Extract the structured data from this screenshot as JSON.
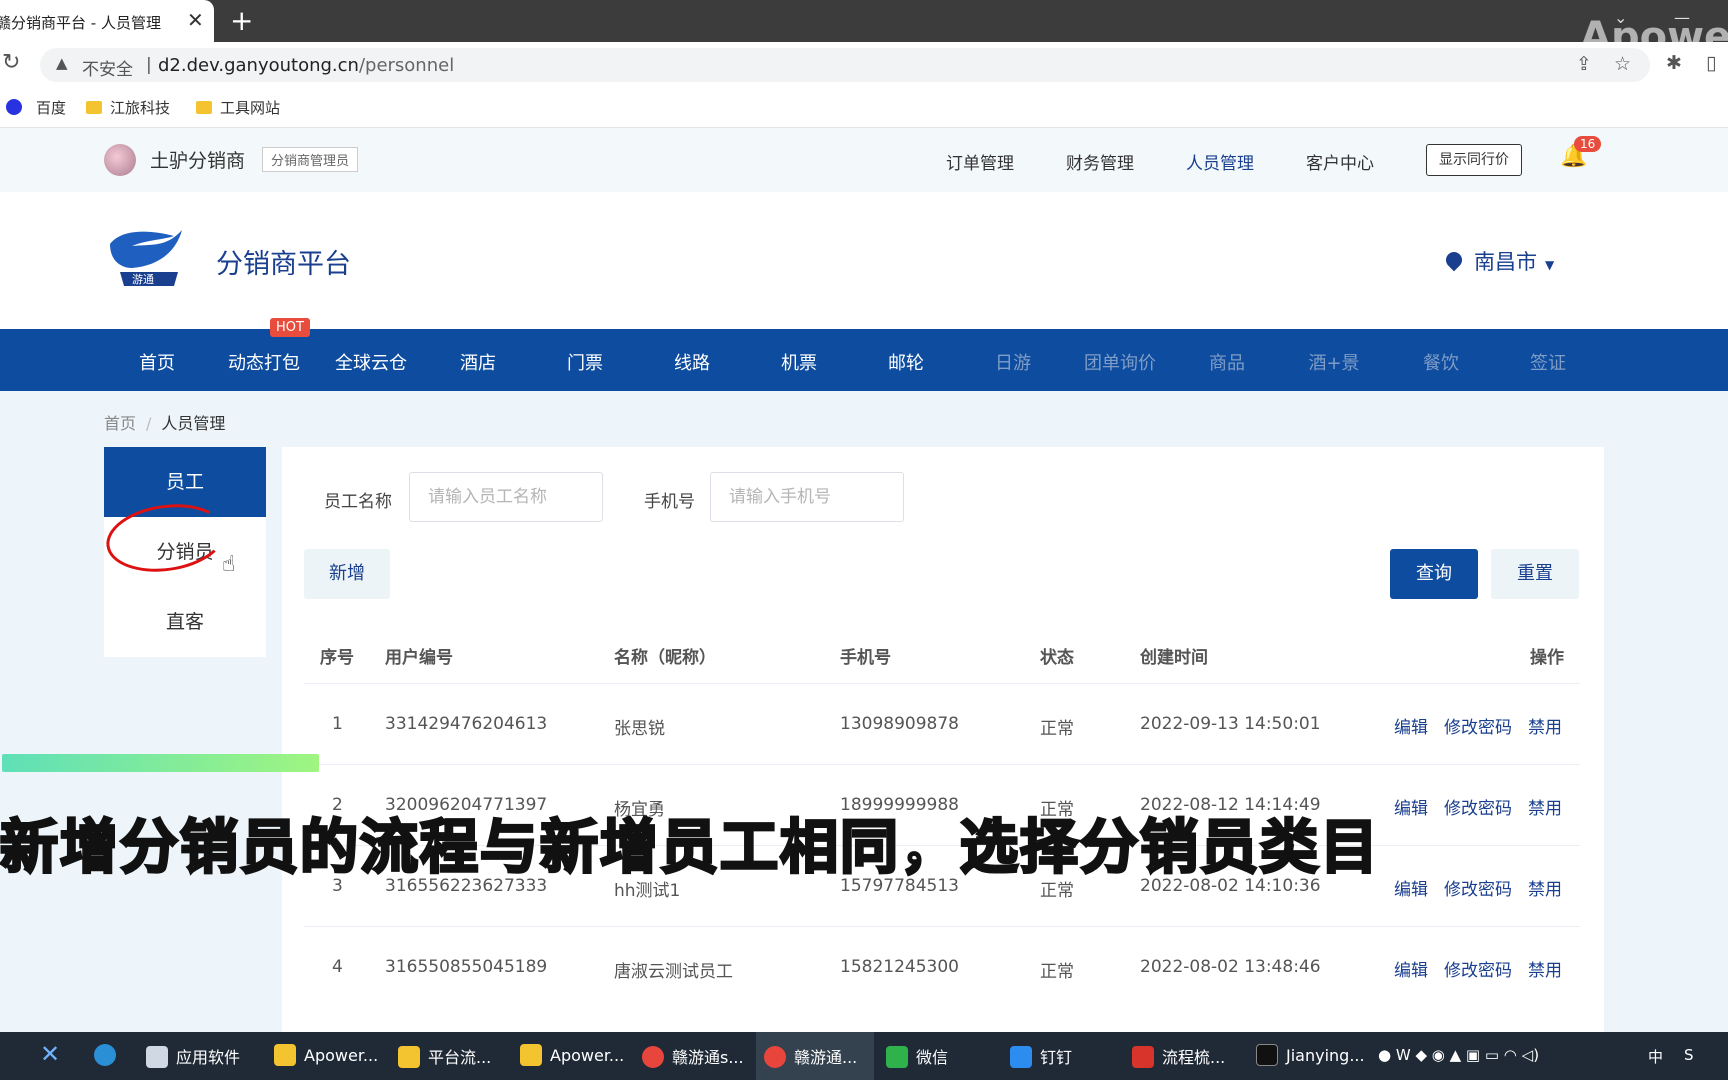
{
  "browser": {
    "tab_title": "赣分销商平台 - 人员管理",
    "tab_close": "✕",
    "new_tab": "+",
    "insecure_label": "不安全",
    "url_host": "d2.dev.ganyoutong.cn",
    "url_path": "/personnel",
    "bookmarks": [
      "百度",
      "江旅科技",
      "工具网站"
    ]
  },
  "topbar": {
    "company": "土驴分销商",
    "role": "分销商管理员",
    "nav": [
      "订单管理",
      "财务管理",
      "人员管理",
      "客户中心"
    ],
    "peer_price_button": "显示同行价",
    "notification_count": "16"
  },
  "header": {
    "platform_name": "分销商平台",
    "city": "南昌市"
  },
  "main_nav": {
    "items": [
      "首页",
      "动态打包",
      "全球云仓",
      "酒店",
      "门票",
      "线路",
      "机票",
      "邮轮",
      "日游",
      "团单询价",
      "商品",
      "酒+景",
      "餐饮",
      "签证"
    ],
    "hot_badge": "HOT"
  },
  "breadcrumb": {
    "home": "首页",
    "sep": "/",
    "current": "人员管理"
  },
  "side_menu": [
    "员工",
    "分销员",
    "直客"
  ],
  "filters": {
    "name_label": "员工名称",
    "name_placeholder": "请输入员工名称",
    "phone_label": "手机号",
    "phone_placeholder": "请输入手机号"
  },
  "buttons": {
    "add": "新增",
    "query": "查询",
    "reset": "重置"
  },
  "table": {
    "headers": [
      "序号",
      "用户编号",
      "名称（昵称）",
      "手机号",
      "状态",
      "创建时间",
      "操作"
    ],
    "actions": [
      "编辑",
      "修改密码",
      "禁用"
    ],
    "rows": [
      {
        "no": "1",
        "user_id": "331429476204613",
        "name": "张思锐",
        "phone": "13098909878",
        "status": "正常",
        "created": "2022-09-13 14:50:01"
      },
      {
        "no": "2",
        "user_id": "320096204771397",
        "name": "杨宜勇",
        "phone": "18999999988",
        "status": "正常",
        "created": "2022-08-12 14:14:49"
      },
      {
        "no": "3",
        "user_id": "316556223627333",
        "name": "hh测试1",
        "phone": "15797784513",
        "status": "正常",
        "created": "2022-08-02 14:10:36"
      },
      {
        "no": "4",
        "user_id": "316550855045189",
        "name": "唐淑云测试员工",
        "phone": "15821245300",
        "status": "正常",
        "created": "2022-08-02 13:48:46"
      }
    ]
  },
  "overlay": {
    "watermark": "Apower",
    "subtitle": "新增分销员的流程与新增员工相同，选择分销员类目"
  },
  "taskbar": {
    "apps": [
      "应用软件",
      "Apower...",
      "平台流...",
      "Apower...",
      "赣游通s...",
      "赣游通...",
      "微信",
      "钉钉",
      "流程梳...",
      "Jianying..."
    ],
    "ime": "中"
  }
}
